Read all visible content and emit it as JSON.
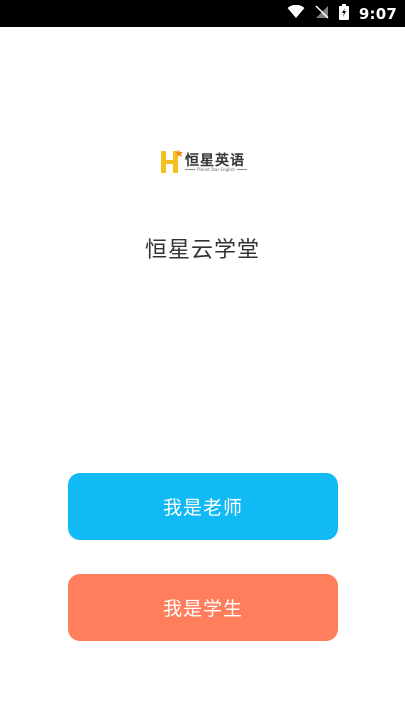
{
  "status_bar": {
    "time": "9:07",
    "icons": [
      "wifi-icon",
      "signal-icon",
      "battery-charging-icon"
    ]
  },
  "logo": {
    "letter": "H",
    "brand_text": "恒星英语",
    "sub_text": "Planet Star English"
  },
  "app_title": "恒星云学堂",
  "buttons": {
    "teacher_label": "我是老师",
    "student_label": "我是学生"
  },
  "colors": {
    "teacher_button": "#12baf5",
    "student_button": "#ff7e5b",
    "logo_yellow": "#f4c020",
    "logo_orange": "#f08a24"
  }
}
